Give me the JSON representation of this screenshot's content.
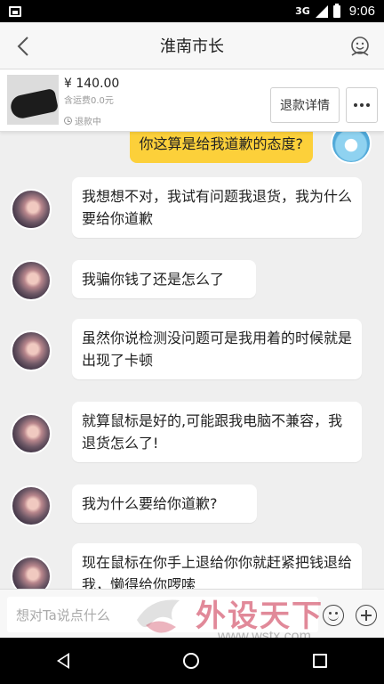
{
  "status_bar": {
    "network": "3G",
    "time": "9:06"
  },
  "header": {
    "title": "淮南市长"
  },
  "product": {
    "price": "¥ 140.00",
    "shipping": "含运费0.0元",
    "status": "退款中",
    "refund_button": "退款详情",
    "more_button": "• • •"
  },
  "messages": [
    {
      "side": "right",
      "text": "你这算是给我道歉的态度?"
    },
    {
      "side": "left",
      "text": "我想想不对，我试有问题我退货，我为什么要给你道歉"
    },
    {
      "side": "left",
      "text": "我骗你钱了还是怎么了"
    },
    {
      "side": "left",
      "text": "虽然你说检测没问题可是我用着的时候就是出现了卡顿"
    },
    {
      "side": "left",
      "text": "就算鼠标是好的,可能跟我电脑不兼容，我退货怎么了!"
    },
    {
      "side": "left",
      "text": "我为什么要给你道歉?"
    },
    {
      "side": "left",
      "text": "现在鼠标在你手上退给你你就赶紧把钱退给我，懒得给你啰嗦"
    }
  ],
  "input": {
    "placeholder": "想对Ta说点什么"
  },
  "watermark": {
    "text": "外设天下",
    "url": "www.wstx.com"
  },
  "icons": {
    "back": "back-arrow-icon",
    "profile": "user-profile-icon",
    "emoji": "emoji-icon",
    "plus": "plus-icon"
  },
  "colors": {
    "accent_bubble": "#fcd03a",
    "background": "#efefef"
  }
}
